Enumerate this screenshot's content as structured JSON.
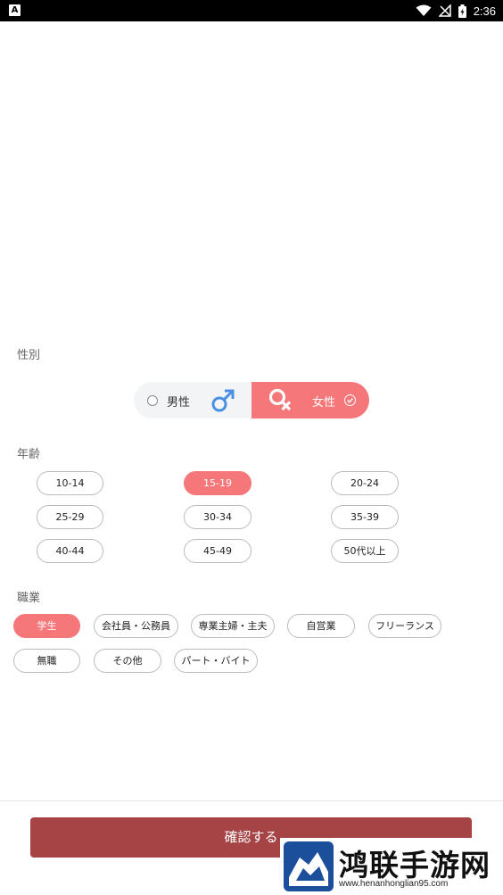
{
  "status_bar": {
    "app_icon_letter": "A",
    "time": "2:36"
  },
  "gender": {
    "label": "性別",
    "options": [
      {
        "label": "男性",
        "selected": false
      },
      {
        "label": "女性",
        "selected": true
      }
    ]
  },
  "age": {
    "label": "年齢",
    "options": [
      "10-14",
      "15-19",
      "20-24",
      "25-29",
      "30-34",
      "35-39",
      "40-44",
      "45-49",
      "50代以上"
    ],
    "selected": "15-19"
  },
  "occupation": {
    "label": "職業",
    "options": [
      "学生",
      "会社員・公務員",
      "専業主婦・主夫",
      "自営業",
      "フリーランス",
      "無職",
      "その他",
      "パート・バイト"
    ],
    "selected": "学生"
  },
  "confirm_button": {
    "label": "確認する"
  },
  "watermark": {
    "title": "鸿联手游网",
    "url": "www.henanhonglian95.com"
  },
  "colors": {
    "accent": "#f6777a",
    "confirm": "#a54345",
    "male_symbol": "#4a90e2"
  }
}
